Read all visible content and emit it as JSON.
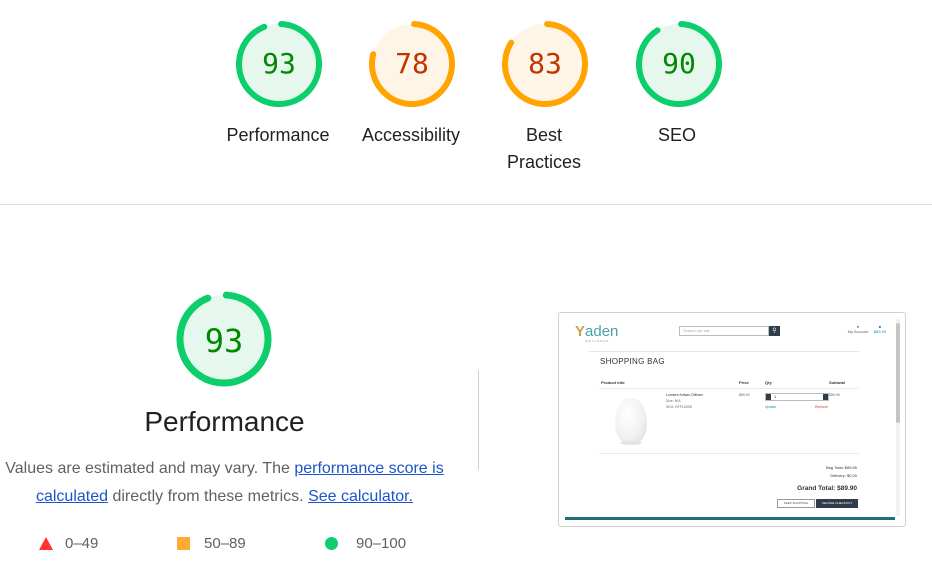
{
  "gauges": [
    {
      "score": "93",
      "value": 93,
      "label_line1": "Performance",
      "label_line2": "",
      "status": "pass"
    },
    {
      "score": "78",
      "value": 78,
      "label_line1": "Accessibility",
      "label_line2": "",
      "status": "average"
    },
    {
      "score": "83",
      "value": 83,
      "label_line1": "Best",
      "label_line2": "Practices",
      "status": "average"
    },
    {
      "score": "90",
      "value": 90,
      "label_line1": "SEO",
      "label_line2": "",
      "status": "pass"
    }
  ],
  "colors": {
    "pass": {
      "stroke": "#0cce6b",
      "fill": "#e6f8ee",
      "text": "#008800"
    },
    "average": {
      "stroke": "#ffa400",
      "fill": "#fff5e6",
      "text": "#c33300"
    },
    "fail": "#ff3333"
  },
  "performance": {
    "score": "93",
    "value": 93,
    "title": "Performance",
    "desc_prefix": "Values are estimated and may vary. The ",
    "link_score": "performance score is calculated",
    "desc_middle": " directly from these metrics. ",
    "link_calculator": "See calculator."
  },
  "legend": {
    "fail": "0–49",
    "average": "50–89",
    "pass": "90–100"
  },
  "thumbnail": {
    "logo": "aden",
    "logo_mark": "Y",
    "logo_sub": "WELLNESS",
    "search_placeholder": "Search our site",
    "account": "My Account",
    "bag_amount": "$89.90",
    "page_title": "SHOPPING BAG",
    "columns": {
      "product": "Product Info",
      "price": "Price",
      "qty": "Qty",
      "subtotal": "Subtotal"
    },
    "product_name": "Lumiere Artisan Diffuser",
    "product_size": "Size: N/A",
    "product_sku": "SKU: DFFL0008",
    "price": "$89.90",
    "qty": "1",
    "update": "Update",
    "remove": "Remove",
    "line_subtotal": "$89.90",
    "bag_total": "Bag Total: $89.90",
    "delivery": "Delivery: $0.00",
    "grand_total": "Grand Total: $89.90",
    "keep_shopping": "KEEP SHOPPING",
    "secure_checkout": "SECURE CHECKOUT"
  }
}
